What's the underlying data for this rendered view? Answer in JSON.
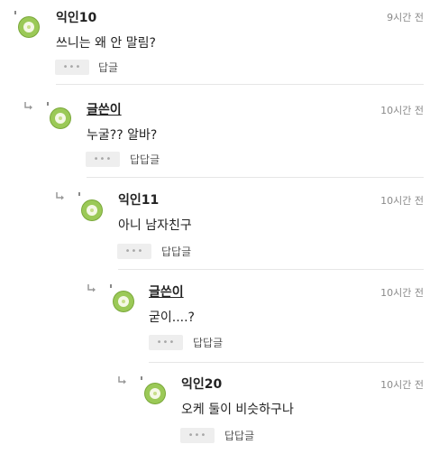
{
  "comments": [
    {
      "nickname": "익인10",
      "time": "9시간 전",
      "text": "쓰니는 왜 안 말림?",
      "more_label": "•••",
      "reply_label": "답글",
      "is_author": false
    },
    {
      "nickname": "글쓴이",
      "time": "10시간 전",
      "text": "누굴?? 알바?",
      "more_label": "•••",
      "reply_label": "답답글",
      "is_author": true
    },
    {
      "nickname": "익인11",
      "time": "10시간 전",
      "text": "아니 남자친구",
      "more_label": "•••",
      "reply_label": "답답글",
      "is_author": false
    },
    {
      "nickname": "글쓴이",
      "time": "10시간 전",
      "text": "굳이....?",
      "more_label": "•••",
      "reply_label": "답답글",
      "is_author": true
    },
    {
      "nickname": "익인20",
      "time": "10시간 전",
      "text": "오케 둘이 비슷하구나",
      "more_label": "•••",
      "reply_label": "답답글",
      "is_author": false
    }
  ],
  "icons": {
    "avatar": "kiwi-avatar-icon",
    "reply_indicator": "reply-arrow-icon",
    "more": "more-dots-icon"
  },
  "colors": {
    "avatar_green": "#9bc957",
    "meta_gray": "#8a8a8a",
    "button_bg": "#eeeeee"
  }
}
